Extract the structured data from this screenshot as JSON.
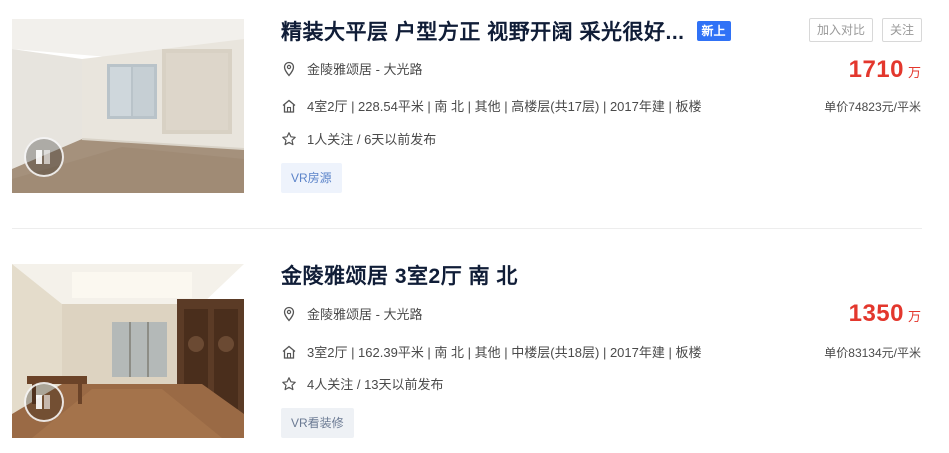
{
  "listings": [
    {
      "title": "精装大平层 户型方正 视野开阔 采光很好...",
      "new_tag": "新上",
      "address": "金陵雅颂居 - 大光路",
      "house_info": "4室2厅 | 228.54平米 | 南 北 | 其他 | 高楼层(共17层) | 2017年建 | 板楼",
      "follow_info": "1人关注 / 6天以前发布",
      "tag": "VR房源",
      "total_price": "1710",
      "price_unit": "万",
      "unit_price": "单价74823元/平米",
      "compare_label": "加入对比",
      "follow_label": "关注"
    },
    {
      "title": "金陵雅颂居 3室2厅 南 北",
      "address": "金陵雅颂居 - 大光路",
      "house_info": "3室2厅 | 162.39平米 | 南 北 | 其他 | 中楼层(共18层) | 2017年建 | 板楼",
      "follow_info": "4人关注 / 13天以前发布",
      "tag": "VR看装修",
      "total_price": "1350",
      "price_unit": "万",
      "unit_price": "单价83134元/平米"
    }
  ],
  "icons": {
    "address": "location-pin-icon",
    "house": "house-icon",
    "follow": "star-icon",
    "vr": "vr-panorama-icon"
  },
  "colors": {
    "price": "#e3372d",
    "new_tag": "#3072f6",
    "title": "#101d37"
  }
}
